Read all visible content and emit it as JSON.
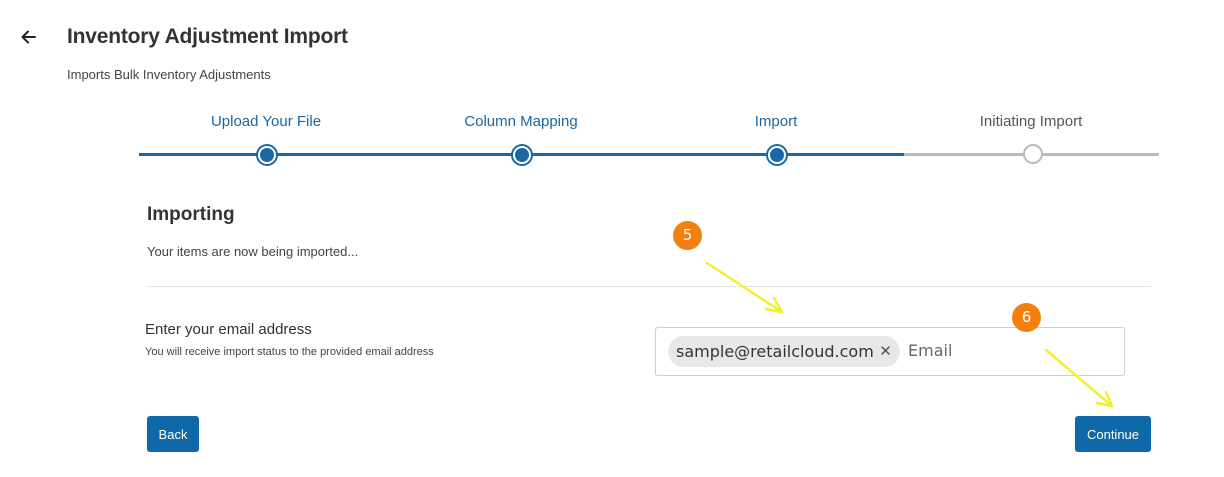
{
  "header": {
    "title": "Inventory Adjustment Import",
    "subtitle": "Imports Bulk Inventory Adjustments"
  },
  "stepper": {
    "steps": [
      {
        "label": "Upload Your File",
        "state": "completed"
      },
      {
        "label": "Column Mapping",
        "state": "completed"
      },
      {
        "label": "Import",
        "state": "current"
      },
      {
        "label": "Initiating Import",
        "state": "pending"
      }
    ]
  },
  "importing": {
    "title": "Importing",
    "message": "Your items are now being imported..."
  },
  "email": {
    "label": "Enter your email address",
    "help": "You will receive import status to the provided email address",
    "chip": "sample@retailcloud.com",
    "placeholder": "Email"
  },
  "buttons": {
    "back": "Back",
    "continue": "Continue"
  },
  "annotations": {
    "badge_5": "5",
    "badge_6": "6"
  },
  "colors": {
    "accent": "#1a67a3",
    "button": "#0f68a8",
    "pending": "#bbbbbb",
    "badge": "#f27f0f",
    "arrow": "#f2f22a"
  }
}
